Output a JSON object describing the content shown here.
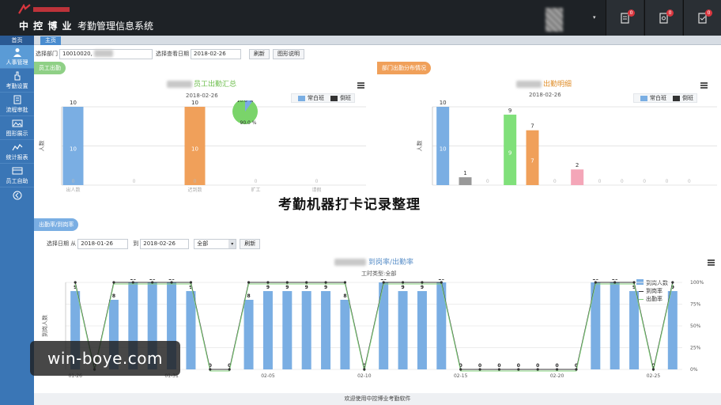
{
  "header": {
    "logo_text": "中 控 博 业",
    "app_title": "考勤管理信息系统",
    "badges": [
      "0",
      "0",
      "0"
    ]
  },
  "sidebar": {
    "home": "首页",
    "items": [
      {
        "label": "人事管理",
        "icon": "person-icon"
      },
      {
        "label": "考勤设置",
        "icon": "hand-icon"
      },
      {
        "label": "流程审批",
        "icon": "document-icon"
      },
      {
        "label": "图形展示",
        "icon": "image-icon"
      },
      {
        "label": "统计报表",
        "icon": "chart-line-icon"
      },
      {
        "label": "员工自助",
        "icon": "card-icon"
      }
    ]
  },
  "tabs": {
    "home": "主页"
  },
  "filter_top": {
    "dept_label": "选择部门",
    "dept_value": "10010020,",
    "date_label": "选择查看日期",
    "date_value": "2018-02-26",
    "refresh": "刷新",
    "help": "图形说明"
  },
  "panel_left": {
    "tag": "员工出勤",
    "title": "员工出勤汇总",
    "subtitle": "2018-02-26"
  },
  "panel_right": {
    "tag": "部门出勤分布情况",
    "title": "出勤明细",
    "subtitle": "2018-02-26"
  },
  "section_bottom": {
    "tag": "出勤率/到岗率",
    "from_label": "选择日期  从",
    "from_value": "2018-01-26",
    "to_label": "到",
    "to_value": "2018-02-26",
    "select_value": "全部",
    "refresh": "刷新",
    "title": "到岗率/出勤率",
    "subtitle": "工时类型:全部"
  },
  "overlay_title": "考勤机器打卡记录整理",
  "watermark": "win-boye.com",
  "footer": "欢迎使用中控博业考勤软件",
  "colors": {
    "blue": "#7aaee3",
    "orange": "#f0a05a",
    "green": "#80e07a",
    "pink": "#f4a6b8",
    "black": "#333333"
  },
  "chart_data": [
    {
      "type": "bar",
      "categories": [
        "出人数",
        "",
        "迟到数",
        "旷工",
        "请假"
      ],
      "series": [
        {
          "name": "常白班",
          "values": [
            10,
            0,
            10,
            0,
            0
          ]
        },
        {
          "name": "倒班",
          "values": [
            0,
            0,
            0,
            0,
            0
          ]
        }
      ],
      "ylabel": "人数",
      "ylim": [
        0,
        10
      ],
      "inset_pie": [
        {
          "label": "10.0 %",
          "value": 10
        },
        {
          "label": "90.0 %",
          "value": 90
        }
      ]
    },
    {
      "type": "bar",
      "categories": [
        "",
        "",
        "",
        "",
        "",
        "",
        "",
        "",
        "",
        "",
        "",
        ""
      ],
      "series": [
        {
          "name": "常白班",
          "values": [
            10,
            1,
            0,
            9,
            7,
            0,
            2,
            0,
            0,
            0,
            0,
            0
          ]
        },
        {
          "name": "倒班",
          "values": [
            0,
            0,
            0,
            0,
            0,
            0,
            0,
            0,
            0,
            0,
            0,
            0
          ]
        }
      ],
      "ylabel": "人数"
    },
    {
      "type": "bar",
      "x_ticks": [
        "01-26",
        "01-31",
        "02-05",
        "02-10",
        "02-15",
        "02-20",
        "02-25"
      ],
      "series": [
        {
          "name": "到岗人数",
          "type": "bar",
          "values": [
            9,
            0,
            8,
            10,
            10,
            10,
            9,
            0,
            0,
            8,
            9,
            9,
            9,
            9,
            8,
            0,
            10,
            9,
            9,
            10,
            0,
            0,
            0,
            0,
            0,
            0,
            0,
            10,
            10,
            9,
            0,
            9
          ]
        },
        {
          "name": "到岗率",
          "type": "line"
        },
        {
          "name": "出勤率",
          "type": "line"
        }
      ],
      "ylabel": "到岗人数",
      "ylim": [
        0,
        10
      ],
      "y2_ticks": [
        "0%",
        "25%",
        "50%",
        "75%",
        "100%"
      ]
    }
  ]
}
